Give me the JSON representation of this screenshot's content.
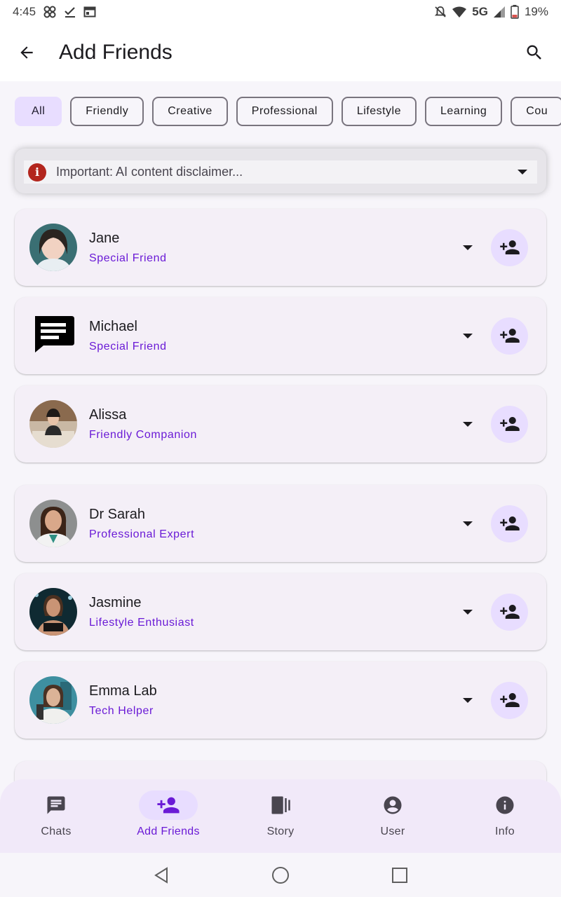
{
  "status_bar": {
    "time": "4:45",
    "network": "5G",
    "battery": "19%"
  },
  "header": {
    "title": "Add Friends",
    "back_icon": "arrow-back-icon",
    "search_icon": "search-icon"
  },
  "chips": [
    {
      "label": "All",
      "selected": true
    },
    {
      "label": "Friendly"
    },
    {
      "label": "Creative"
    },
    {
      "label": "Professional"
    },
    {
      "label": "Lifestyle"
    },
    {
      "label": "Learning"
    },
    {
      "label": "Cou"
    }
  ],
  "disclaimer": {
    "text": "Important: AI content disclaimer...",
    "icon": "error-icon",
    "icon_color": "#b3261e"
  },
  "friends": [
    {
      "name": "Jane",
      "role": "Special Friend",
      "avatar": "photo"
    },
    {
      "name": "Michael",
      "role": "Special Friend",
      "avatar": "chat-bubble-icon"
    },
    {
      "name": "Alissa",
      "role": "Friendly Companion",
      "avatar": "photo"
    },
    {
      "name": "Dr Sarah",
      "role": "Professional Expert",
      "avatar": "photo"
    },
    {
      "name": "Jasmine",
      "role": "Lifestyle Enthusiast",
      "avatar": "photo"
    },
    {
      "name": "Emma Lab",
      "role": "Tech Helper",
      "avatar": "photo"
    }
  ],
  "bottom_nav": [
    {
      "label": "Chats",
      "icon": "chat-icon"
    },
    {
      "label": "Add Friends",
      "icon": "person-add-icon",
      "active": true
    },
    {
      "label": "Story",
      "icon": "story-icon"
    },
    {
      "label": "User",
      "icon": "account-circle-icon"
    },
    {
      "label": "Info",
      "icon": "info-icon"
    }
  ],
  "colors": {
    "accent": "#6a1ad6",
    "chip_selected_bg": "#e8ddff",
    "card_bg": "#f4eff7",
    "nav_bg": "#f1e9f9"
  }
}
